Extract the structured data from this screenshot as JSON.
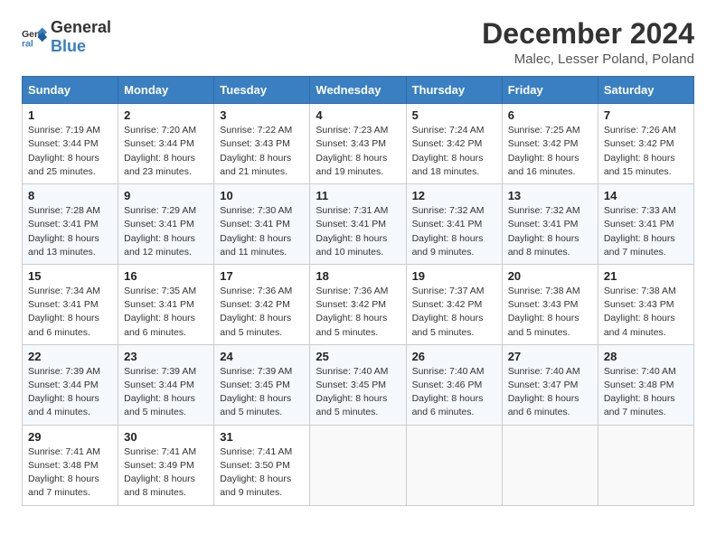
{
  "logo": {
    "text_general": "General",
    "text_blue": "Blue"
  },
  "title": "December 2024",
  "subtitle": "Malec, Lesser Poland, Poland",
  "header_days": [
    "Sunday",
    "Monday",
    "Tuesday",
    "Wednesday",
    "Thursday",
    "Friday",
    "Saturday"
  ],
  "weeks": [
    [
      {
        "day": "1",
        "sunrise": "Sunrise: 7:19 AM",
        "sunset": "Sunset: 3:44 PM",
        "daylight": "Daylight: 8 hours and 25 minutes."
      },
      {
        "day": "2",
        "sunrise": "Sunrise: 7:20 AM",
        "sunset": "Sunset: 3:44 PM",
        "daylight": "Daylight: 8 hours and 23 minutes."
      },
      {
        "day": "3",
        "sunrise": "Sunrise: 7:22 AM",
        "sunset": "Sunset: 3:43 PM",
        "daylight": "Daylight: 8 hours and 21 minutes."
      },
      {
        "day": "4",
        "sunrise": "Sunrise: 7:23 AM",
        "sunset": "Sunset: 3:43 PM",
        "daylight": "Daylight: 8 hours and 19 minutes."
      },
      {
        "day": "5",
        "sunrise": "Sunrise: 7:24 AM",
        "sunset": "Sunset: 3:42 PM",
        "daylight": "Daylight: 8 hours and 18 minutes."
      },
      {
        "day": "6",
        "sunrise": "Sunrise: 7:25 AM",
        "sunset": "Sunset: 3:42 PM",
        "daylight": "Daylight: 8 hours and 16 minutes."
      },
      {
        "day": "7",
        "sunrise": "Sunrise: 7:26 AM",
        "sunset": "Sunset: 3:42 PM",
        "daylight": "Daylight: 8 hours and 15 minutes."
      }
    ],
    [
      {
        "day": "8",
        "sunrise": "Sunrise: 7:28 AM",
        "sunset": "Sunset: 3:41 PM",
        "daylight": "Daylight: 8 hours and 13 minutes."
      },
      {
        "day": "9",
        "sunrise": "Sunrise: 7:29 AM",
        "sunset": "Sunset: 3:41 PM",
        "daylight": "Daylight: 8 hours and 12 minutes."
      },
      {
        "day": "10",
        "sunrise": "Sunrise: 7:30 AM",
        "sunset": "Sunset: 3:41 PM",
        "daylight": "Daylight: 8 hours and 11 minutes."
      },
      {
        "day": "11",
        "sunrise": "Sunrise: 7:31 AM",
        "sunset": "Sunset: 3:41 PM",
        "daylight": "Daylight: 8 hours and 10 minutes."
      },
      {
        "day": "12",
        "sunrise": "Sunrise: 7:32 AM",
        "sunset": "Sunset: 3:41 PM",
        "daylight": "Daylight: 8 hours and 9 minutes."
      },
      {
        "day": "13",
        "sunrise": "Sunrise: 7:32 AM",
        "sunset": "Sunset: 3:41 PM",
        "daylight": "Daylight: 8 hours and 8 minutes."
      },
      {
        "day": "14",
        "sunrise": "Sunrise: 7:33 AM",
        "sunset": "Sunset: 3:41 PM",
        "daylight": "Daylight: 8 hours and 7 minutes."
      }
    ],
    [
      {
        "day": "15",
        "sunrise": "Sunrise: 7:34 AM",
        "sunset": "Sunset: 3:41 PM",
        "daylight": "Daylight: 8 hours and 6 minutes."
      },
      {
        "day": "16",
        "sunrise": "Sunrise: 7:35 AM",
        "sunset": "Sunset: 3:41 PM",
        "daylight": "Daylight: 8 hours and 6 minutes."
      },
      {
        "day": "17",
        "sunrise": "Sunrise: 7:36 AM",
        "sunset": "Sunset: 3:42 PM",
        "daylight": "Daylight: 8 hours and 5 minutes."
      },
      {
        "day": "18",
        "sunrise": "Sunrise: 7:36 AM",
        "sunset": "Sunset: 3:42 PM",
        "daylight": "Daylight: 8 hours and 5 minutes."
      },
      {
        "day": "19",
        "sunrise": "Sunrise: 7:37 AM",
        "sunset": "Sunset: 3:42 PM",
        "daylight": "Daylight: 8 hours and 5 minutes."
      },
      {
        "day": "20",
        "sunrise": "Sunrise: 7:38 AM",
        "sunset": "Sunset: 3:43 PM",
        "daylight": "Daylight: 8 hours and 5 minutes."
      },
      {
        "day": "21",
        "sunrise": "Sunrise: 7:38 AM",
        "sunset": "Sunset: 3:43 PM",
        "daylight": "Daylight: 8 hours and 4 minutes."
      }
    ],
    [
      {
        "day": "22",
        "sunrise": "Sunrise: 7:39 AM",
        "sunset": "Sunset: 3:44 PM",
        "daylight": "Daylight: 8 hours and 4 minutes."
      },
      {
        "day": "23",
        "sunrise": "Sunrise: 7:39 AM",
        "sunset": "Sunset: 3:44 PM",
        "daylight": "Daylight: 8 hours and 5 minutes."
      },
      {
        "day": "24",
        "sunrise": "Sunrise: 7:39 AM",
        "sunset": "Sunset: 3:45 PM",
        "daylight": "Daylight: 8 hours and 5 minutes."
      },
      {
        "day": "25",
        "sunrise": "Sunrise: 7:40 AM",
        "sunset": "Sunset: 3:45 PM",
        "daylight": "Daylight: 8 hours and 5 minutes."
      },
      {
        "day": "26",
        "sunrise": "Sunrise: 7:40 AM",
        "sunset": "Sunset: 3:46 PM",
        "daylight": "Daylight: 8 hours and 6 minutes."
      },
      {
        "day": "27",
        "sunrise": "Sunrise: 7:40 AM",
        "sunset": "Sunset: 3:47 PM",
        "daylight": "Daylight: 8 hours and 6 minutes."
      },
      {
        "day": "28",
        "sunrise": "Sunrise: 7:40 AM",
        "sunset": "Sunset: 3:48 PM",
        "daylight": "Daylight: 8 hours and 7 minutes."
      }
    ],
    [
      {
        "day": "29",
        "sunrise": "Sunrise: 7:41 AM",
        "sunset": "Sunset: 3:48 PM",
        "daylight": "Daylight: 8 hours and 7 minutes."
      },
      {
        "day": "30",
        "sunrise": "Sunrise: 7:41 AM",
        "sunset": "Sunset: 3:49 PM",
        "daylight": "Daylight: 8 hours and 8 minutes."
      },
      {
        "day": "31",
        "sunrise": "Sunrise: 7:41 AM",
        "sunset": "Sunset: 3:50 PM",
        "daylight": "Daylight: 8 hours and 9 minutes."
      },
      null,
      null,
      null,
      null
    ]
  ]
}
